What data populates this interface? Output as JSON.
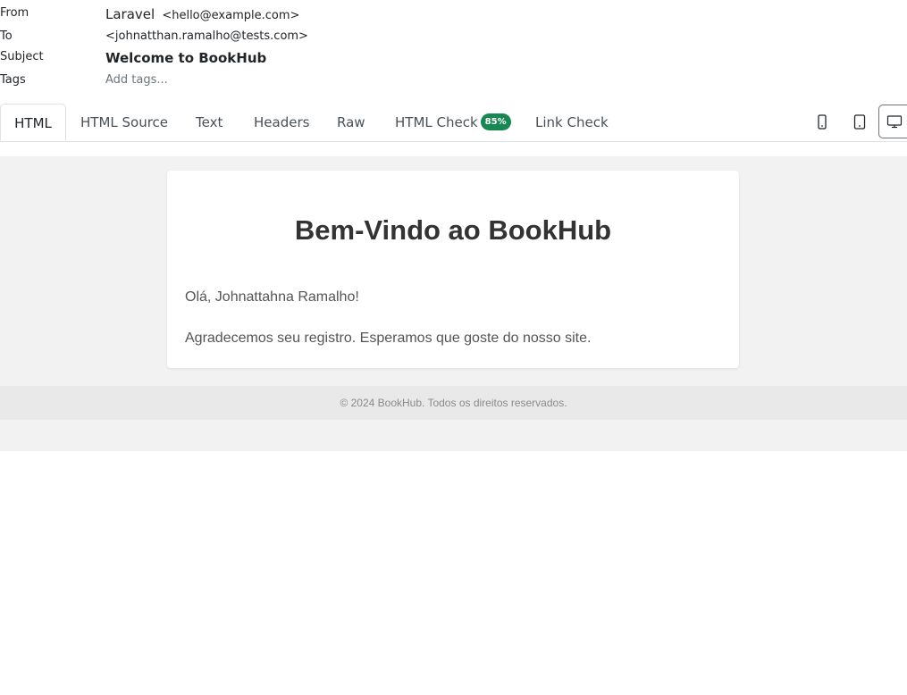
{
  "headers": {
    "from_label": "From",
    "from_name": "Laravel",
    "from_address": "<hello@example.com>",
    "to_label": "To",
    "to_address": "<johnatthan.ramalho@tests.com>",
    "subject_label": "Subject",
    "subject": "Welcome to BookHub",
    "tags_label": "Tags",
    "tags_placeholder": "Add tags..."
  },
  "tabs": [
    {
      "label": "HTML",
      "active": true
    },
    {
      "label": "HTML Source"
    },
    {
      "label": "Text"
    },
    {
      "label": "Headers"
    },
    {
      "label": "Raw"
    },
    {
      "label": "HTML Check",
      "badge": "85%"
    },
    {
      "label": "Link Check"
    }
  ],
  "device_buttons": [
    "phone-icon",
    "tablet-icon",
    "desktop-icon"
  ],
  "email": {
    "title": "Bem-Vindo ao BookHub",
    "greeting": "Olá, Johnattahna Ramalho!",
    "body": "Agradecemos seu registro. Esperamos que goste do nosso site.",
    "footer": "© 2024 BookHub. Todos os direitos reservados."
  },
  "colors": {
    "badge": "#198754",
    "preview_background": "#f2f2f2",
    "footer_background": "#e9e9e9"
  }
}
